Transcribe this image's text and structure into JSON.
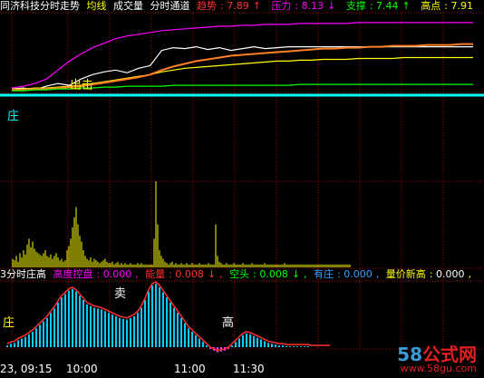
{
  "header_top": {
    "title": "同济科技分时走势",
    "avg_line": "均线",
    "volume": "成交量",
    "channel": "分时通道",
    "trend_label": "趋势",
    "trend_value": "7.89",
    "trend_arrow": "↑",
    "pressure_label": "压力",
    "pressure_value": "8.13",
    "pressure_arrow": "↓",
    "support_label": "支撑",
    "support_value": "7.44",
    "support_arrow": "↑",
    "high_label": "高点",
    "high_value": "7.91"
  },
  "header_bottom": {
    "title": "3分时庄高",
    "control_label": "高度控盘",
    "control_value": "0.000",
    "energy_label": "能量",
    "energy_value": "0.008",
    "energy_arrow": "↓",
    "bear_label": "空头",
    "bear_value": "0.008",
    "bear_arrow": "↓",
    "dealer_label": "有庄",
    "dealer_value": "0.000",
    "volprice_label": "量价新高",
    "volprice_value": "0.000"
  },
  "annotations": {
    "chu": "出击",
    "zhuang_top": "庄",
    "mai": "卖",
    "zhuang_bottom": "庄",
    "gao": "高"
  },
  "time_axis": [
    "23, 09:15",
    "10:00",
    "11:00",
    "11:30"
  ],
  "watermark": {
    "brand": "58",
    "name": "公式网",
    "url": "www.58gu.com"
  },
  "colors": {
    "price": "#ffffff",
    "avg": "#ffff00",
    "pressure": "#ff00ff",
    "trend": "#ff7f27",
    "support": "#00ff00",
    "baseline": "#00ffff",
    "volume": "#ffff00",
    "grid": "#b00000",
    "bar_pos": "#00ccff",
    "bar_neg": "#ff33ff"
  },
  "chart_data": [
    {
      "type": "line",
      "series": [
        {
          "values": [
            7.39,
            7.4,
            7.38,
            7.42,
            7.45,
            7.43,
            7.5,
            7.55,
            7.58,
            7.6,
            7.57,
            7.62,
            7.65,
            7.82,
            7.85,
            7.84,
            7.86,
            7.83,
            7.85,
            7.82,
            7.84,
            7.86,
            7.84,
            7.85,
            7.86,
            7.86,
            7.86,
            7.86,
            7.86,
            7.86,
            7.86,
            7.86,
            7.86,
            7.86,
            7.86,
            7.86,
            7.86,
            7.86,
            7.86,
            7.86,
            7.86
          ]
        },
        {
          "values": [
            7.39,
            7.39,
            7.4,
            7.4,
            7.41,
            7.42,
            7.43,
            7.45,
            7.47,
            7.49,
            7.51,
            7.53,
            7.55,
            7.58,
            7.6,
            7.62,
            7.63,
            7.64,
            7.65,
            7.66,
            7.67,
            7.68,
            7.69,
            7.7,
            7.7,
            7.71,
            7.71,
            7.72,
            7.72,
            7.72,
            7.73,
            7.73,
            7.73,
            7.73,
            7.74,
            7.74,
            7.74,
            7.74,
            7.74,
            7.74,
            7.74
          ]
        },
        {
          "values": [
            7.38,
            7.38,
            7.39,
            7.39,
            7.4,
            7.41,
            7.42,
            7.44,
            7.46,
            7.48,
            7.5,
            7.52,
            7.55,
            7.6,
            7.64,
            7.67,
            7.7,
            7.72,
            7.74,
            7.76,
            7.77,
            7.78,
            7.79,
            7.8,
            7.81,
            7.82,
            7.83,
            7.84,
            7.84,
            7.85,
            7.85,
            7.86,
            7.86,
            7.87,
            7.87,
            7.87,
            7.88,
            7.88,
            7.88,
            7.89,
            7.89
          ]
        },
        {
          "values": [
            7.4,
            7.42,
            7.45,
            7.5,
            7.6,
            7.7,
            7.78,
            7.85,
            7.9,
            7.95,
            7.98,
            8.0,
            8.02,
            8.04,
            8.05,
            8.06,
            8.07,
            8.08,
            8.09,
            8.09,
            8.1,
            8.1,
            8.11,
            8.11,
            8.11,
            8.12,
            8.12,
            8.12,
            8.12,
            8.12,
            8.13,
            8.13,
            8.13,
            8.13,
            8.13,
            8.13,
            8.13,
            8.13,
            8.13,
            8.13,
            8.13
          ]
        },
        {
          "values": [
            7.37,
            7.37,
            7.38,
            7.38,
            7.39,
            7.39,
            7.4,
            7.4,
            7.41,
            7.41,
            7.42,
            7.42,
            7.42,
            7.42,
            7.43,
            7.43,
            7.43,
            7.43,
            7.43,
            7.43,
            7.43,
            7.43,
            7.43,
            7.43,
            7.43,
            7.44,
            7.44,
            7.44,
            7.44,
            7.44,
            7.44,
            7.44,
            7.44,
            7.44,
            7.44,
            7.44,
            7.44,
            7.44,
            7.44,
            7.44,
            7.44
          ]
        }
      ],
      "ylim": [
        7.32,
        8.2
      ]
    },
    {
      "type": "bar",
      "values": [
        6,
        5,
        8,
        4,
        10,
        7,
        12,
        9,
        16,
        20,
        14,
        18,
        13,
        11,
        10,
        9,
        8,
        10,
        12,
        8,
        7,
        9,
        6,
        8,
        10,
        7,
        5,
        6,
        4,
        5,
        12,
        15,
        20,
        28,
        35,
        42,
        30,
        22,
        18,
        12,
        8,
        6,
        5,
        7,
        4,
        6,
        5,
        4,
        3,
        4,
        5,
        6,
        4,
        3,
        3,
        4,
        2,
        3,
        4,
        2,
        3,
        2,
        3,
        2,
        2,
        3,
        2,
        2,
        2,
        3,
        2,
        3,
        2,
        2,
        2,
        2,
        2,
        2,
        20,
        60,
        30,
        12,
        8,
        6,
        4,
        3,
        2,
        3,
        4,
        2,
        3,
        2,
        2,
        3,
        2,
        2,
        3,
        2,
        2,
        3,
        2,
        2,
        2,
        3,
        2,
        2,
        2,
        2,
        3,
        2,
        2,
        2,
        30,
        8,
        4,
        3,
        2,
        2,
        3,
        2,
        2,
        2,
        3,
        2,
        2,
        2,
        2,
        3,
        2,
        2,
        2,
        2,
        3,
        2,
        2,
        2,
        2,
        2,
        2,
        3,
        2,
        2,
        2,
        2,
        2,
        2,
        2,
        2,
        2,
        2,
        3,
        2,
        2,
        2,
        2,
        2,
        2,
        2,
        2,
        2,
        2,
        2,
        2,
        2,
        2,
        2,
        2,
        2,
        2,
        2,
        2,
        2,
        2,
        2,
        2,
        2,
        2,
        2,
        2,
        2,
        2,
        2,
        2,
        2,
        2,
        2,
        2
      ]
    },
    {
      "type": "bar",
      "values": [
        2,
        4,
        5,
        8,
        10,
        12,
        15,
        18,
        22,
        26,
        30,
        34,
        40,
        45,
        52,
        58,
        62,
        66,
        68,
        65,
        60,
        55,
        50,
        48,
        46,
        45,
        44,
        42,
        40,
        38,
        36,
        34,
        33,
        32,
        34,
        36,
        40,
        46,
        55,
        65,
        72,
        74,
        70,
        64,
        58,
        52,
        46,
        40,
        34,
        28,
        22,
        18,
        14,
        10,
        6,
        2,
        -2,
        -4,
        -6,
        -5,
        -4,
        -2,
        2,
        6,
        10,
        14,
        16,
        15,
        13,
        11,
        9,
        7,
        5,
        4,
        3,
        2,
        2,
        1,
        1,
        1,
        1,
        1,
        1,
        1,
        0,
        0,
        0,
        0,
        0,
        0
      ]
    }
  ]
}
